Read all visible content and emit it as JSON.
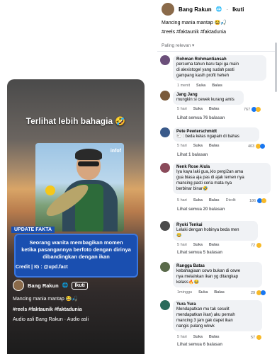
{
  "reel": {
    "overlay_title": "Terlihat lebih bahagia 🤣",
    "photo_label": "infof",
    "update_tag": "UPDATE FAKTA",
    "info_text": "Seorang wanita membagikan momen ketika pasangannya berfoto dengan dirinya dibandingkan dengan ikan",
    "credit": "Credit | IG : @upd.fact",
    "author": "Bang Rakun",
    "follow": "Ikuti",
    "caption": "Mancing mania mantap 😂🎣",
    "tags": "#reels #faktaunik #faktadunia",
    "audio": "Audio asli    Bang Rakun · Audio asli"
  },
  "post": {
    "author": "Bang Rakun",
    "follow": "Ikuti",
    "text": "Mancing mania mantap 😂🎣",
    "tags": "#reels #faktaunik #faktadunia",
    "sort": "Paling relevan ▾"
  },
  "comments": [
    {
      "name": "Rohman Rohmantiansah",
      "lines": [
        "percuma tahun baru tapi ga main",
        "di alexistogel yang sudah pasti",
        "gampang kasih profit heheh"
      ],
      "time": "1 menit",
      "like": "Suka",
      "reply": "Balas",
      "avatar_color": "#6b4f7a"
    },
    {
      "name": "Jang Jang",
      "lines": [
        "mungkin si cewek kurang amis"
      ],
      "time": "5 hari",
      "like": "Suka",
      "reply": "Balas",
      "count": "767",
      "replies": "Lihat semua 76 balasan",
      "avatar_color": "#7a5a3a"
    },
    {
      "name": "Pete Pewterschmidt",
      "lines": [
        "🐑 : beda kelas ngapain di bahas"
      ],
      "time": "5 hari",
      "like": "Suka",
      "reply": "Balas",
      "count": "403",
      "replies": "Lihat 1 balasan",
      "avatar_color": "#3a5a8a"
    },
    {
      "name": "Nenk Rose Alula",
      "lines": [
        "Iya kaya laki gua,,klo pergi2an ama",
        "gua biasa aja pas di ajak temen nya",
        "mancing pasti ceria mata nya",
        "berbinar binar🤣"
      ],
      "time": "5 hari",
      "like": "Suka",
      "reply": "Balas",
      "edited": "Diedit",
      "count": "186",
      "replies": "Lihat semua 20 balasan",
      "avatar_color": "#8a4a5a"
    },
    {
      "name": "Ryoki Tenkai",
      "lines": [
        "Lelaki dengan hobinya beda men",
        "😂"
      ],
      "time": "5 hari",
      "like": "Suka",
      "reply": "Balas",
      "count": "72",
      "replies": "Lihat semua 5 balasan",
      "avatar_color": "#4a4a4a"
    },
    {
      "name": "Rangga Batas",
      "lines": [
        "kebahagiaan cowo bukan di cewe",
        "nya melainkan ikan yg ditangkap",
        "kelass🔥😂"
      ],
      "time": "1minggu",
      "like": "Suka",
      "reply": "Balas",
      "count": "29",
      "avatar_color": "#5a6a4a"
    },
    {
      "name": "Yura Yura",
      "lines": [
        "Mendapatkan mu tak sesulit",
        "mendapatkan ikan) aku pernah",
        "mancing 3 jam gak dapet ikan",
        "nangis pulang wkwk"
      ],
      "time": "5 hari",
      "like": "Suka",
      "reply": "Balas",
      "count": "57",
      "replies": "Lihat semua 6 balasan",
      "avatar_color": "#2a6a5a"
    }
  ]
}
